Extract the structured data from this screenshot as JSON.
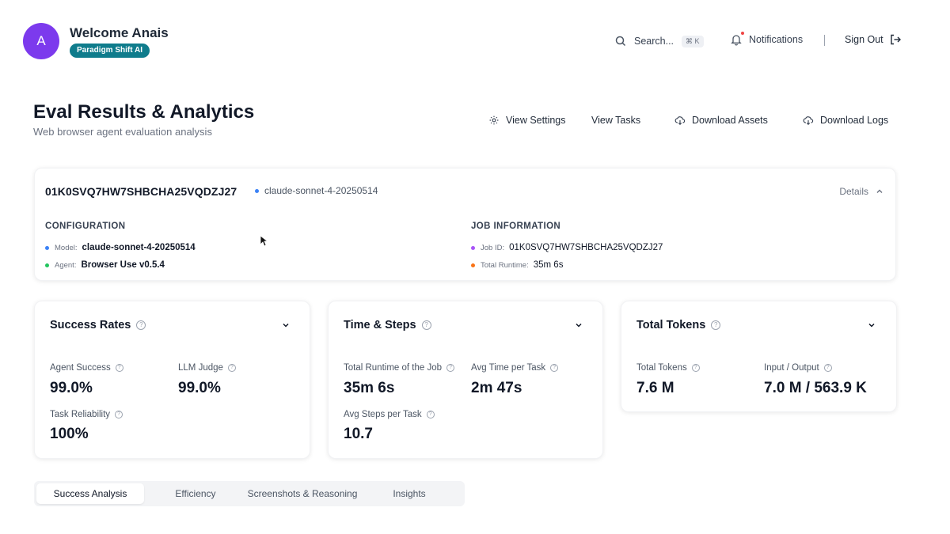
{
  "header": {
    "avatar_initial": "A",
    "welcome": "Welcome Anais",
    "org_badge": "Paradigm Shift AI",
    "search_label": "Search...",
    "search_shortcut": "⌘ K",
    "notifications_label": "Notifications",
    "separator": "|",
    "signout_label": "Sign Out",
    "avatar_color": "#7c3aed",
    "badge_color": "#0f7c8c"
  },
  "page": {
    "title": "Eval Results & Analytics",
    "subtitle": "Web browser agent evaluation analysis"
  },
  "actions": [
    {
      "label": "View Settings",
      "icon": "gear-icon"
    },
    {
      "label": "View Tasks",
      "icon": ""
    },
    {
      "label": "Download Assets",
      "icon": "cloud-download-icon"
    },
    {
      "label": "Download Logs",
      "icon": "cloud-download-icon"
    }
  ],
  "job": {
    "id": "01K0SVQ7HW7SHBCHA25VQDZJ27",
    "model_tag": "claude-sonnet-4-20250514",
    "details_label": "Details",
    "configuration": {
      "heading": "CONFIGURATION",
      "model_key": "Model:",
      "model_value": "claude-sonnet-4-20250514",
      "agent_key": "Agent:",
      "agent_value": "Browser Use v0.5.4"
    },
    "job_information": {
      "heading": "JOB INFORMATION",
      "job_id_key": "Job ID:",
      "job_id_value": "01K0SVQ7HW7SHBCHA25VQDZJ27",
      "runtime_key": "Total Runtime:",
      "runtime_value": "35m 6s"
    },
    "bullet_colors": {
      "model": "#3b82f6",
      "agent": "#22c55e",
      "job_id": "#a855f7",
      "runtime": "#f97316"
    }
  },
  "success_rates": {
    "title": "Success Rates",
    "agent_success_label": "Agent Success",
    "agent_success_value": "99.0%",
    "llm_judge_label": "LLM Judge",
    "llm_judge_value": "99.0%",
    "task_reliability_label": "Task Reliability",
    "task_reliability_value": "100%"
  },
  "time_steps": {
    "title": "Time & Steps",
    "runtime_label": "Total Runtime of the Job",
    "runtime_value": "35m 6s",
    "avg_time_label": "Avg Time per Task",
    "avg_time_value": "2m 47s",
    "avg_steps_label": "Avg Steps per Task",
    "avg_steps_value": "10.7"
  },
  "tokens": {
    "title": "Total Tokens",
    "total_label": "Total Tokens",
    "total_value": "7.6 M",
    "io_label": "Input / Output",
    "io_value": "7.0 M / 563.9 K"
  },
  "tabs": [
    {
      "label": "Success Analysis",
      "active": true
    },
    {
      "label": "Efficiency",
      "active": false
    },
    {
      "label": "Screenshots & Reasoning",
      "active": false
    },
    {
      "label": "Insights",
      "active": false
    }
  ]
}
